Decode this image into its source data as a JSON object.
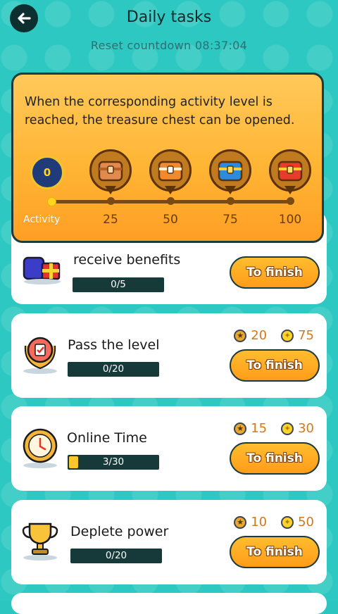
{
  "header": {
    "title": "Daily tasks",
    "countdown_label": "Reset countdown",
    "countdown_time": "08:37:04"
  },
  "activity": {
    "description": "When the corresponding activity level is reached, the treasure chest can be opened.",
    "current_level": "0",
    "start_label": "Activity",
    "milestones": [
      {
        "label": "25",
        "chest": "brown-chest-icon"
      },
      {
        "label": "50",
        "chest": "orange-chest-icon"
      },
      {
        "label": "75",
        "chest": "blue-chest-icon"
      },
      {
        "label": "100",
        "chest": "red-chest-icon"
      }
    ],
    "progress_fraction": 0
  },
  "tasks": [
    {
      "name": "receive benefits",
      "progress": "0/5",
      "progress_fraction": 0,
      "button": "To finish"
    },
    {
      "name": "Pass the level",
      "progress": "0/20",
      "progress_fraction": 0,
      "reward_star": "20",
      "reward_coin": "75",
      "button": "To finish"
    },
    {
      "name": "Online Time",
      "progress": "3/30",
      "progress_fraction": 0.1,
      "reward_star": "15",
      "reward_coin": "30",
      "button": "To finish"
    },
    {
      "name": "Deplete power",
      "progress": "0/20",
      "progress_fraction": 0,
      "reward_star": "10",
      "reward_coin": "50",
      "button": "To finish"
    }
  ],
  "colors": {
    "background": "#2ec8c2",
    "panel": "#ffb534",
    "button": "#ffa61f",
    "progress_bg": "#163a3a",
    "reward_text": "#d6771a"
  }
}
